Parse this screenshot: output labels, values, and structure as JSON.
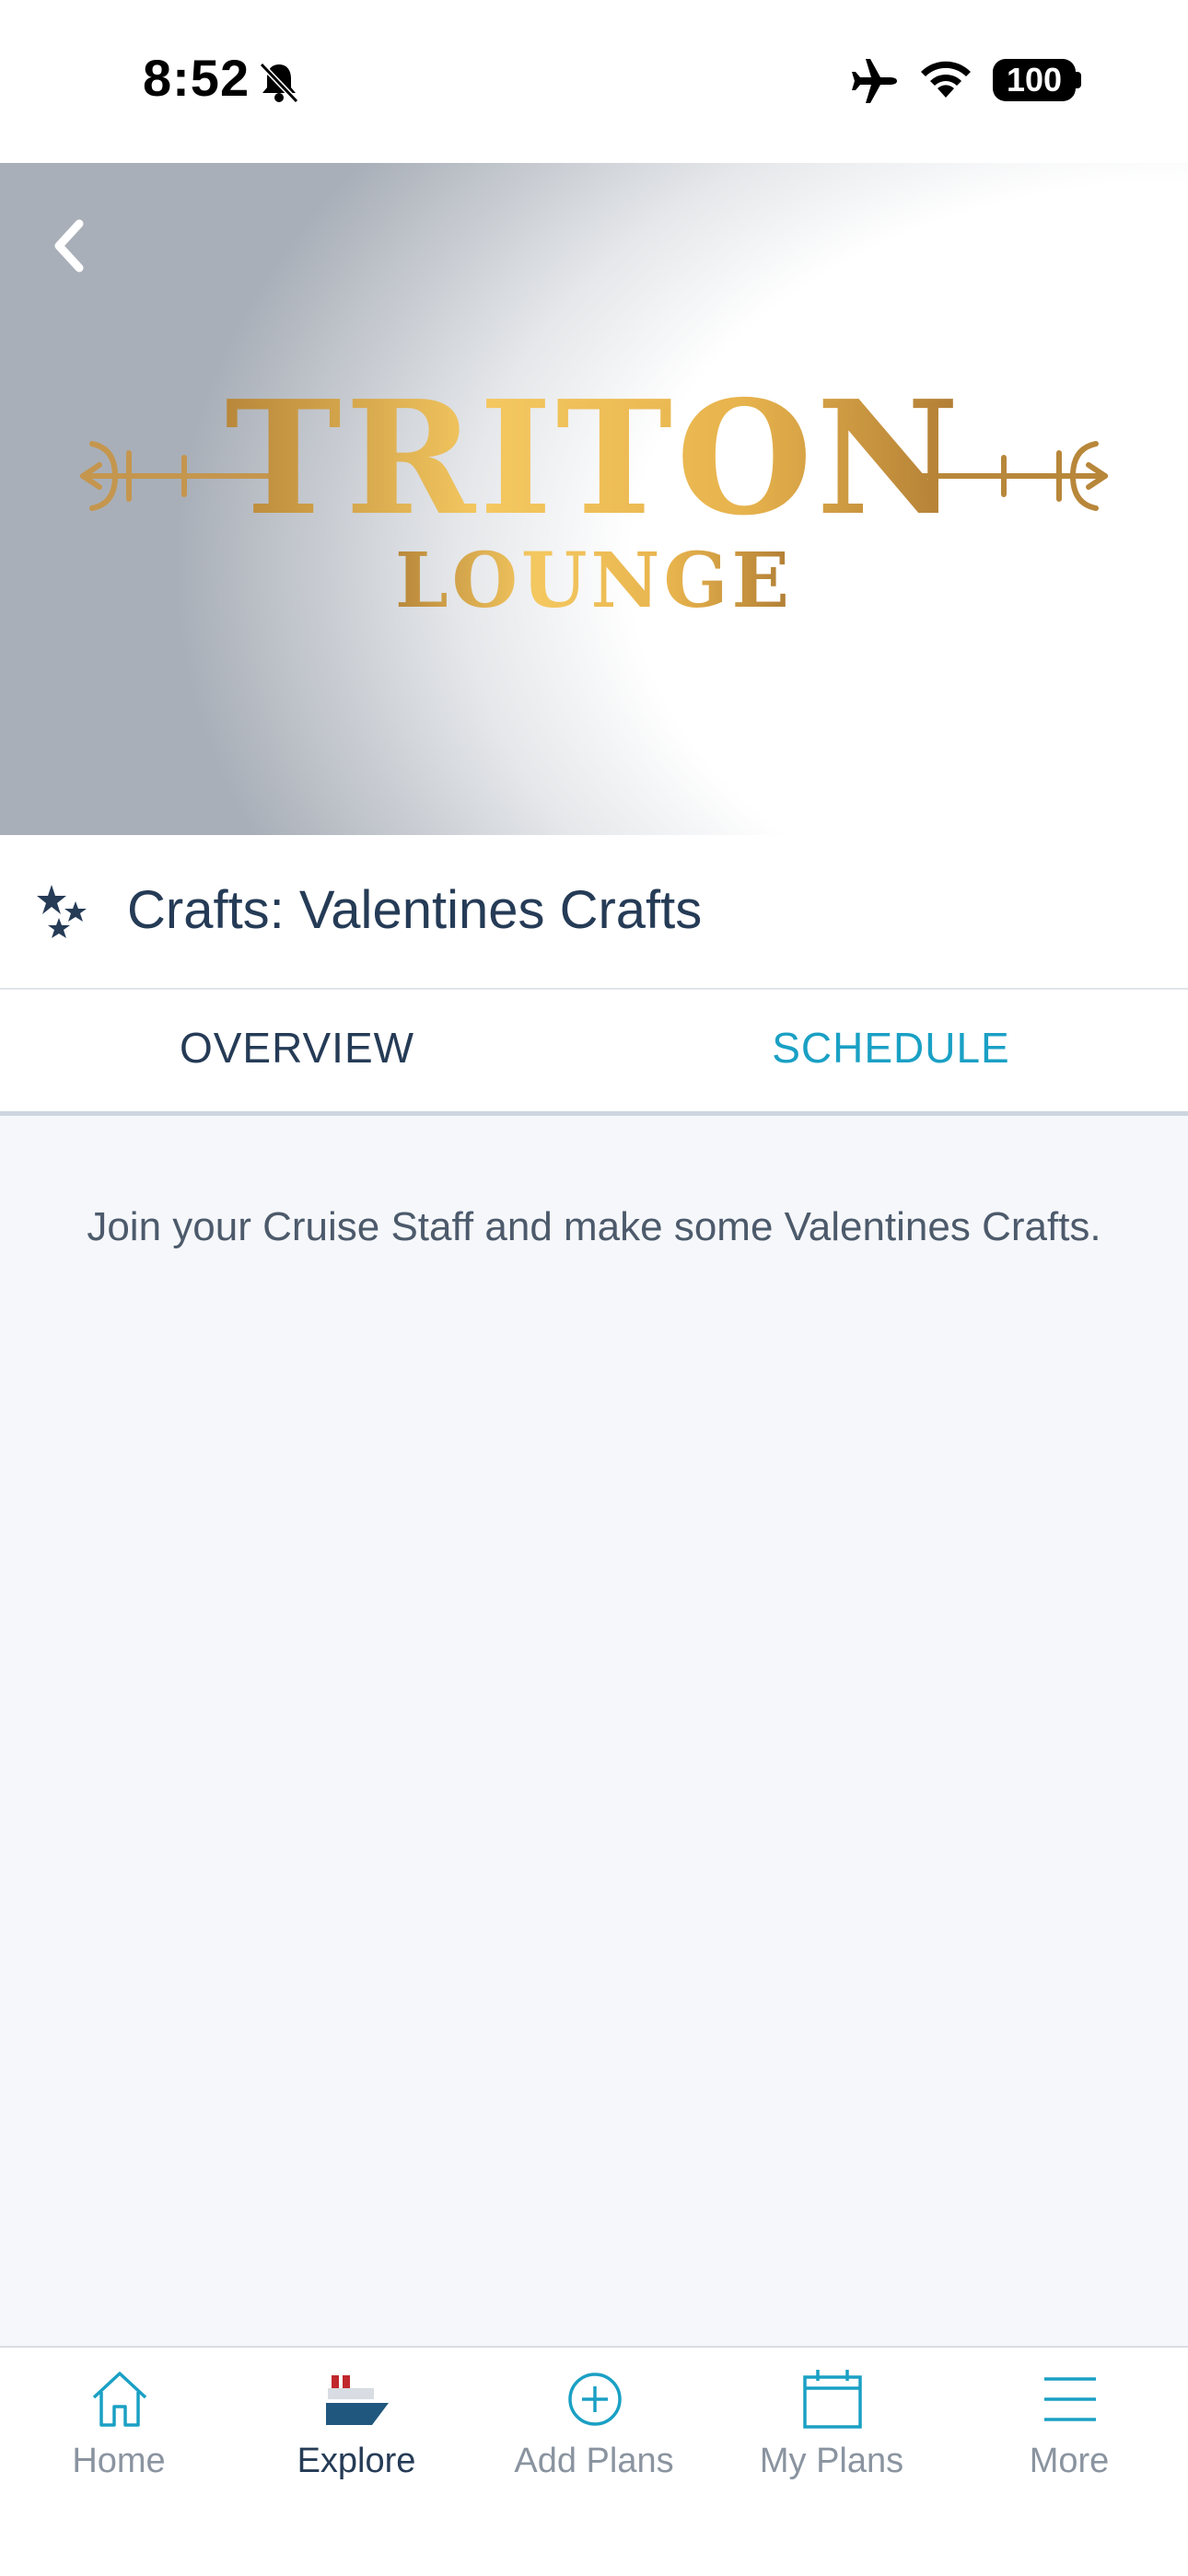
{
  "status_bar": {
    "time": "8:52",
    "battery": "100",
    "icons": [
      "bell-muted-icon",
      "airplane-icon",
      "wifi-icon",
      "battery-icon"
    ]
  },
  "hero": {
    "logo_title": "TRITON",
    "logo_subtitle": "LOUNGE",
    "logo_color": "#d9a13a"
  },
  "header": {
    "icon": "stars-icon",
    "title": "Crafts: Valentines Crafts"
  },
  "tabs": [
    {
      "label": "OVERVIEW",
      "active": false
    },
    {
      "label": "SCHEDULE",
      "active": true
    }
  ],
  "content": {
    "description": "Join your Cruise Staff and make some Valentines Crafts."
  },
  "bottom_nav": [
    {
      "label": "Home",
      "icon": "home-icon",
      "active": false
    },
    {
      "label": "Explore",
      "icon": "ship-icon",
      "active": true
    },
    {
      "label": "Add Plans",
      "icon": "add-circle-icon",
      "active": false
    },
    {
      "label": "My Plans",
      "icon": "calendar-icon",
      "active": false
    },
    {
      "label": "More",
      "icon": "menu-icon",
      "active": false
    }
  ],
  "colors": {
    "text_primary": "#253b56",
    "accent": "#1aa0c4",
    "content_bg": "#f5f7fa",
    "nav_inactive": "#8a94a0"
  }
}
